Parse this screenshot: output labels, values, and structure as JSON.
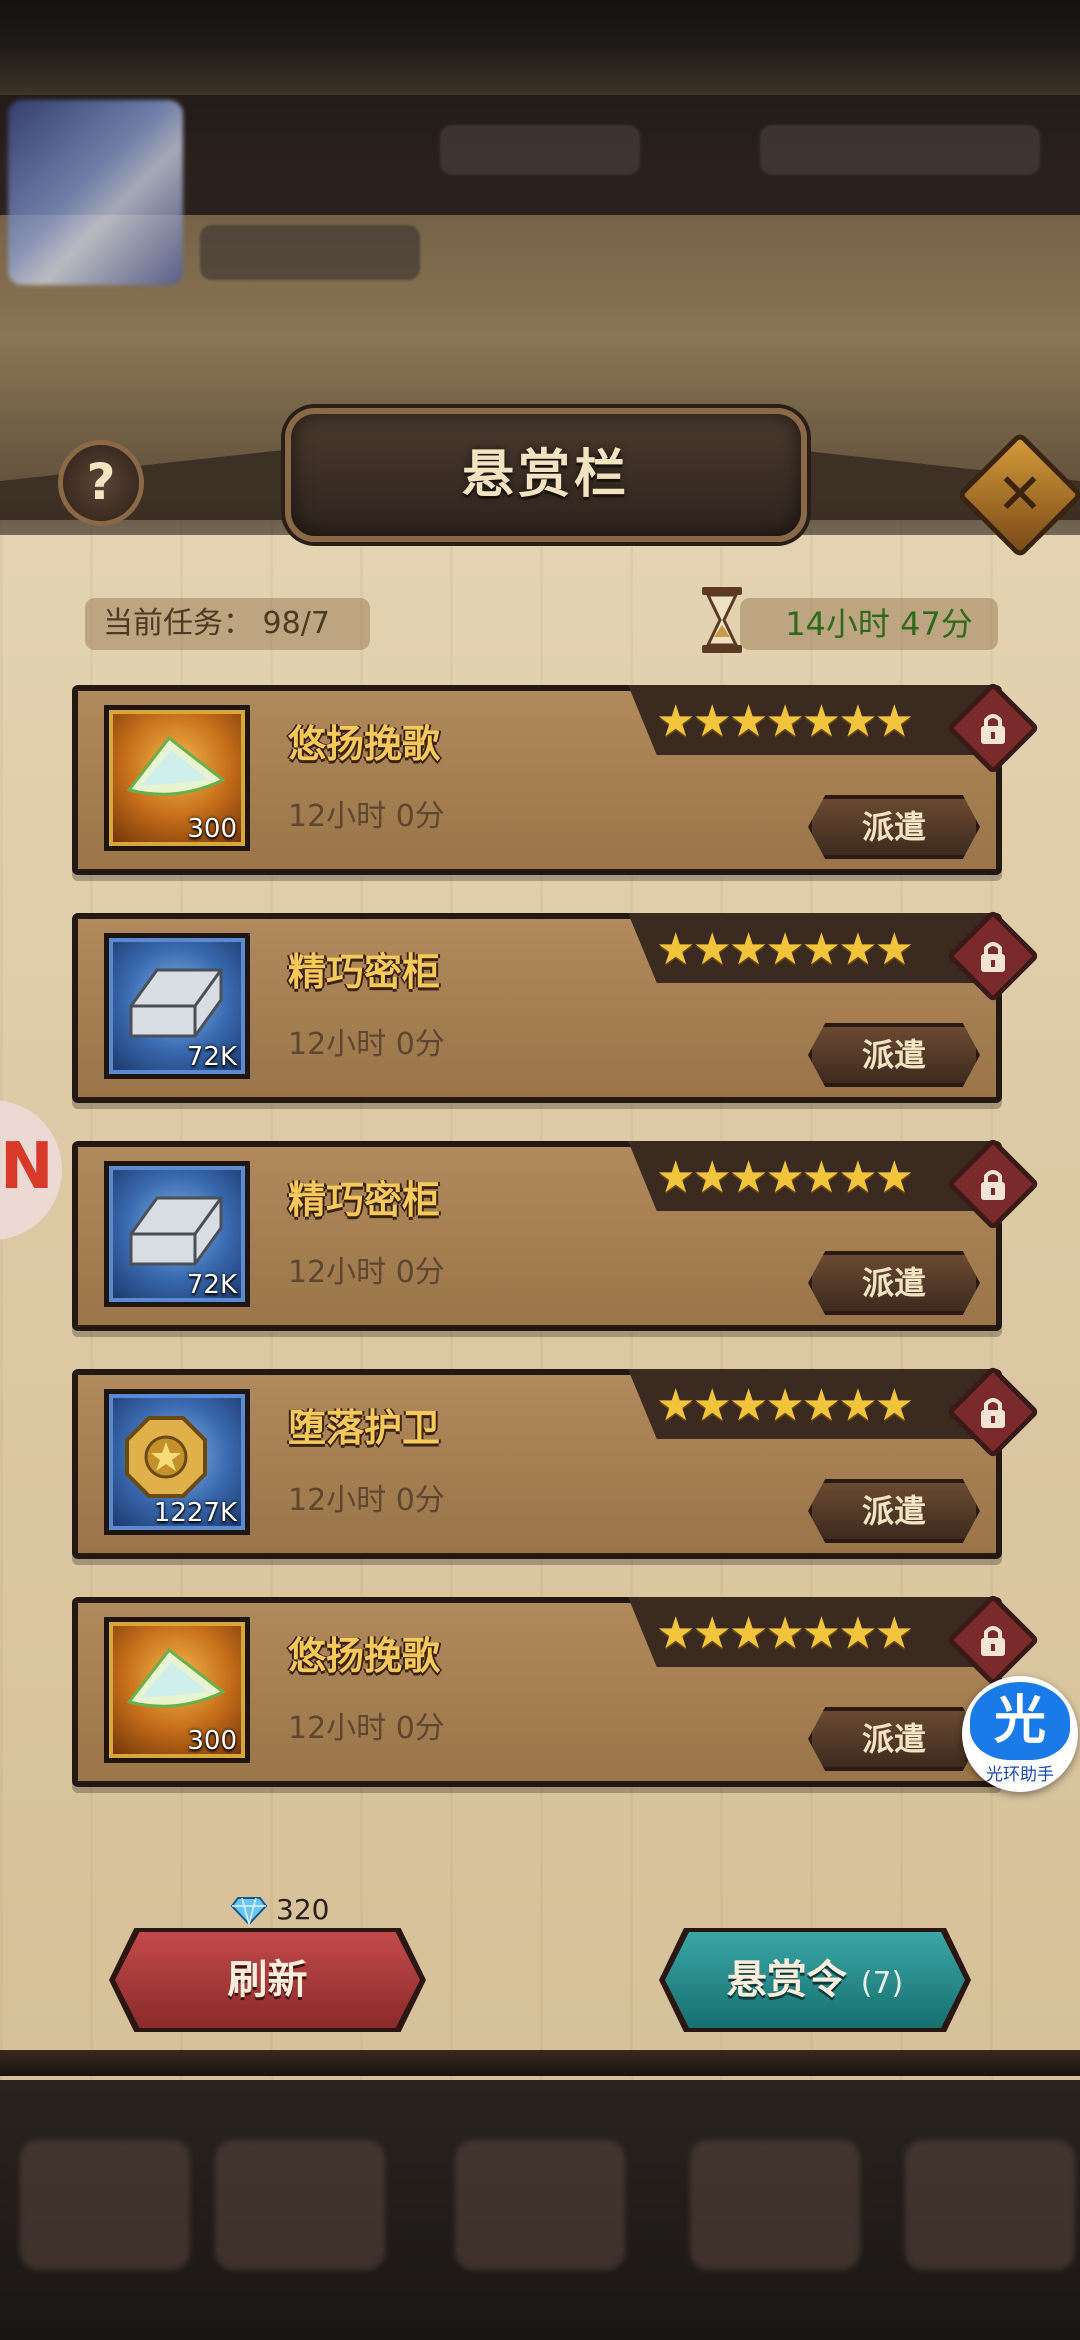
{
  "header": {
    "title": "悬赏栏",
    "help_label": "?",
    "close_label": "✕"
  },
  "status": {
    "current_tasks_label": "当前任务：",
    "current_tasks_value": "98/7",
    "timer": "14小时 47分"
  },
  "quests": [
    {
      "name": "悠扬挽歌",
      "time": "12小时 0分",
      "qty": "300",
      "item": "crystal-shard-icon",
      "frame": "gold",
      "stars": 7,
      "action": "派遣"
    },
    {
      "name": "精巧密柜",
      "time": "12小时 0分",
      "qty": "72K",
      "item": "silver-ingot-icon",
      "frame": "blue",
      "stars": 7,
      "action": "派遣"
    },
    {
      "name": "精巧密柜",
      "time": "12小时 0分",
      "qty": "72K",
      "item": "silver-ingot-icon",
      "frame": "blue",
      "stars": 7,
      "action": "派遣"
    },
    {
      "name": "堕落护卫",
      "time": "12小时 0分",
      "qty": "1227K",
      "item": "gold-coin-icon",
      "frame": "blue",
      "stars": 7,
      "action": "派遣"
    },
    {
      "name": "悠扬挽歌",
      "time": "12小时 0分",
      "qty": "300",
      "item": "crystal-shard-icon",
      "frame": "gold",
      "stars": 7,
      "action": "派遣"
    }
  ],
  "footer": {
    "refresh_cost": "320",
    "refresh_label": "刷新",
    "bounty_label": "悬赏令",
    "bounty_count": "(7)"
  },
  "overlay": {
    "helper_glyph": "光",
    "helper_text": "光环助手"
  },
  "colors": {
    "star": "#f2c43c",
    "quest_name": "#f7c95a",
    "timer_text": "#2f6a1c",
    "refresh_button": "#c44a4a",
    "bounty_button": "#3aa6a6"
  }
}
